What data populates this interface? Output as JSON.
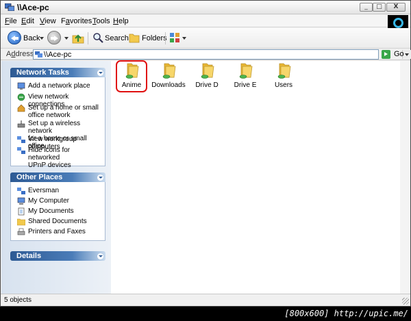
{
  "window": {
    "title": "\\\\Ace-pc",
    "buttons": {
      "minimize": "_",
      "maximize": "□",
      "close": "X"
    }
  },
  "menu": {
    "items": [
      {
        "label": "File",
        "accel": "F",
        "rest": "ile"
      },
      {
        "label": "Edit",
        "accel": "E",
        "rest": "dit"
      },
      {
        "label": "View",
        "accel": "V",
        "rest": "iew"
      },
      {
        "label": "Favorites",
        "accel": "a",
        "pre": "F",
        "rest": "vorites"
      },
      {
        "label": "Tools",
        "accel": "T",
        "rest": "ools"
      },
      {
        "label": "Help",
        "accel": "H",
        "rest": "elp"
      }
    ]
  },
  "toolbar": {
    "back_label": "Back",
    "search_label": "Search",
    "folders_label": "Folders"
  },
  "address": {
    "label_accel": "d",
    "label_pre": "A",
    "label_rest": "dress",
    "value": "\\\\Ace-pc",
    "go_label": "Go"
  },
  "network_tasks": {
    "title": "Network Tasks",
    "items": [
      {
        "label": "Add a network place",
        "icon": "network-place-icon"
      },
      {
        "label": "View network connections",
        "icon": "network-connections-icon"
      },
      {
        "label": "Set up a home or small office network",
        "line1": "Set up a home or small",
        "line2": "office network",
        "icon": "home-network-icon"
      },
      {
        "label": "Set up a wireless network for a home or small office",
        "line1": "Set up a wireless network",
        "line2": "for a home or small office",
        "icon": "wireless-network-icon"
      },
      {
        "label": "View workgroup computers",
        "icon": "workgroup-icon"
      },
      {
        "label": "Hide icons for networked UPnP devices",
        "line1": "Hide icons for networked",
        "line2": "UPnP devices",
        "icon": "upnp-icon"
      }
    ]
  },
  "other_places": {
    "title": "Other Places",
    "items": [
      {
        "label": "Eversman",
        "icon": "network-icon"
      },
      {
        "label": "My Computer",
        "icon": "computer-icon"
      },
      {
        "label": "My Documents",
        "icon": "documents-icon"
      },
      {
        "label": "Shared Documents",
        "icon": "shared-folder-icon"
      },
      {
        "label": "Printers and Faxes",
        "icon": "printer-icon"
      }
    ]
  },
  "details": {
    "title": "Details"
  },
  "folders": [
    {
      "label": "Anime",
      "highlighted": true
    },
    {
      "label": "Downloads"
    },
    {
      "label": "Drive D"
    },
    {
      "label": "Drive E"
    },
    {
      "label": "Users"
    }
  ],
  "status": {
    "text": "5 objects"
  },
  "watermark": "[800x600] http://upic.me/",
  "colors": {
    "task_header": "#2d5a94",
    "highlight": "#e01010",
    "folder": "#f2c94c"
  }
}
